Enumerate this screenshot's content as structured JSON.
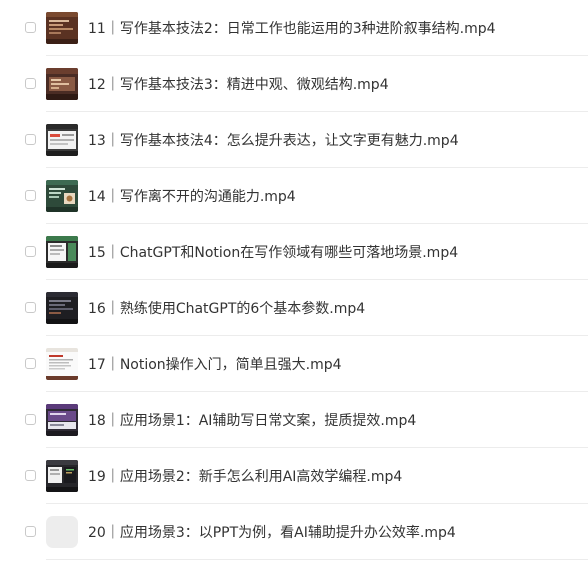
{
  "files": [
    {
      "name": "11｜写作基本技法2：日常工作也能运用的3种进阶叙事结构.mp4",
      "thumb": "video-thumbnail-icon"
    },
    {
      "name": "12｜写作基本技法3：精进中观、微观结构.mp4",
      "thumb": "video-thumbnail-icon"
    },
    {
      "name": "13｜写作基本技法4：怎么提升表达，让文字更有魅力.mp4",
      "thumb": "video-thumbnail-icon"
    },
    {
      "name": "14｜写作离不开的沟通能力.mp4",
      "thumb": "video-thumbnail-icon"
    },
    {
      "name": "15｜ChatGPT和Notion在写作领域有哪些可落地场景.mp4",
      "thumb": "video-thumbnail-icon"
    },
    {
      "name": "16｜熟练使用ChatGPT的6个基本参数.mp4",
      "thumb": "video-thumbnail-icon"
    },
    {
      "name": "17｜Notion操作入门，简单且强大.mp4",
      "thumb": "video-thumbnail-icon"
    },
    {
      "name": "18｜应用场景1：AI辅助写日常文案，提质提效.mp4",
      "thumb": "video-thumbnail-icon"
    },
    {
      "name": "19｜应用场景2：新手怎么利用AI高效学编程.mp4",
      "thumb": "video-thumbnail-icon"
    },
    {
      "name": "20｜应用场景3：以PPT为例，看AI辅助提升办公效率.mp4",
      "thumb": "video-file-placeholder-icon"
    }
  ]
}
